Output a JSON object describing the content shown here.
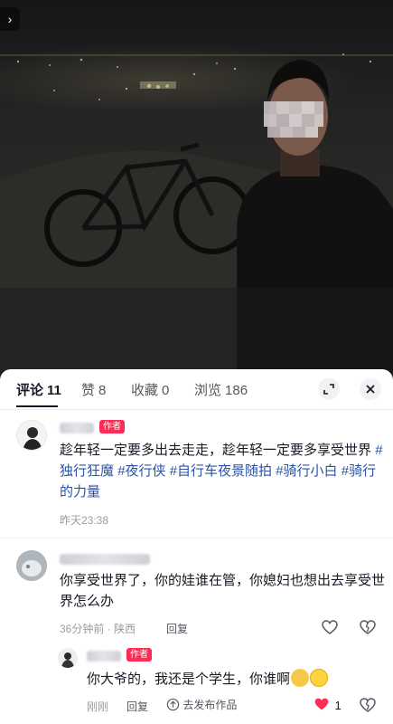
{
  "nav": {
    "back_glyph": "›"
  },
  "tabs": [
    {
      "label": "评论",
      "count": "11"
    },
    {
      "label": "赞",
      "count": "8"
    },
    {
      "label": "收藏",
      "count": "0"
    },
    {
      "label": "浏览",
      "count": "186"
    }
  ],
  "comments": {
    "main": {
      "badge": "作者",
      "text_plain": "趁年轻一定要多出去走走，趁年轻一定要多享受世界",
      "hashtags": [
        "#独行狂魔",
        "#夜行侠",
        "#自行车夜景随拍",
        "#骑行小白",
        "#骑行的力量"
      ],
      "time": "昨天23:38"
    },
    "second": {
      "text": "你享受世界了，你的娃谁在管，你媳妇也想出去享受世界怎么办",
      "time": "36分钟前",
      "location": "陕西",
      "reply_label": "回复"
    },
    "reply": {
      "badge": "作者",
      "text": "你大爷的，我还是个学生，你谁啊",
      "time": "刚刚",
      "reply_label": "回复",
      "publish_label": "去发布作品",
      "like_count": "1"
    }
  },
  "colors": {
    "accent": "#fe2c55",
    "hashtag": "#2b52a9"
  },
  "icons": [
    "chevron-right-icon",
    "expand-icon",
    "close-icon",
    "heart-icon",
    "broken-heart-icon",
    "up-arrow-circle-icon"
  ]
}
